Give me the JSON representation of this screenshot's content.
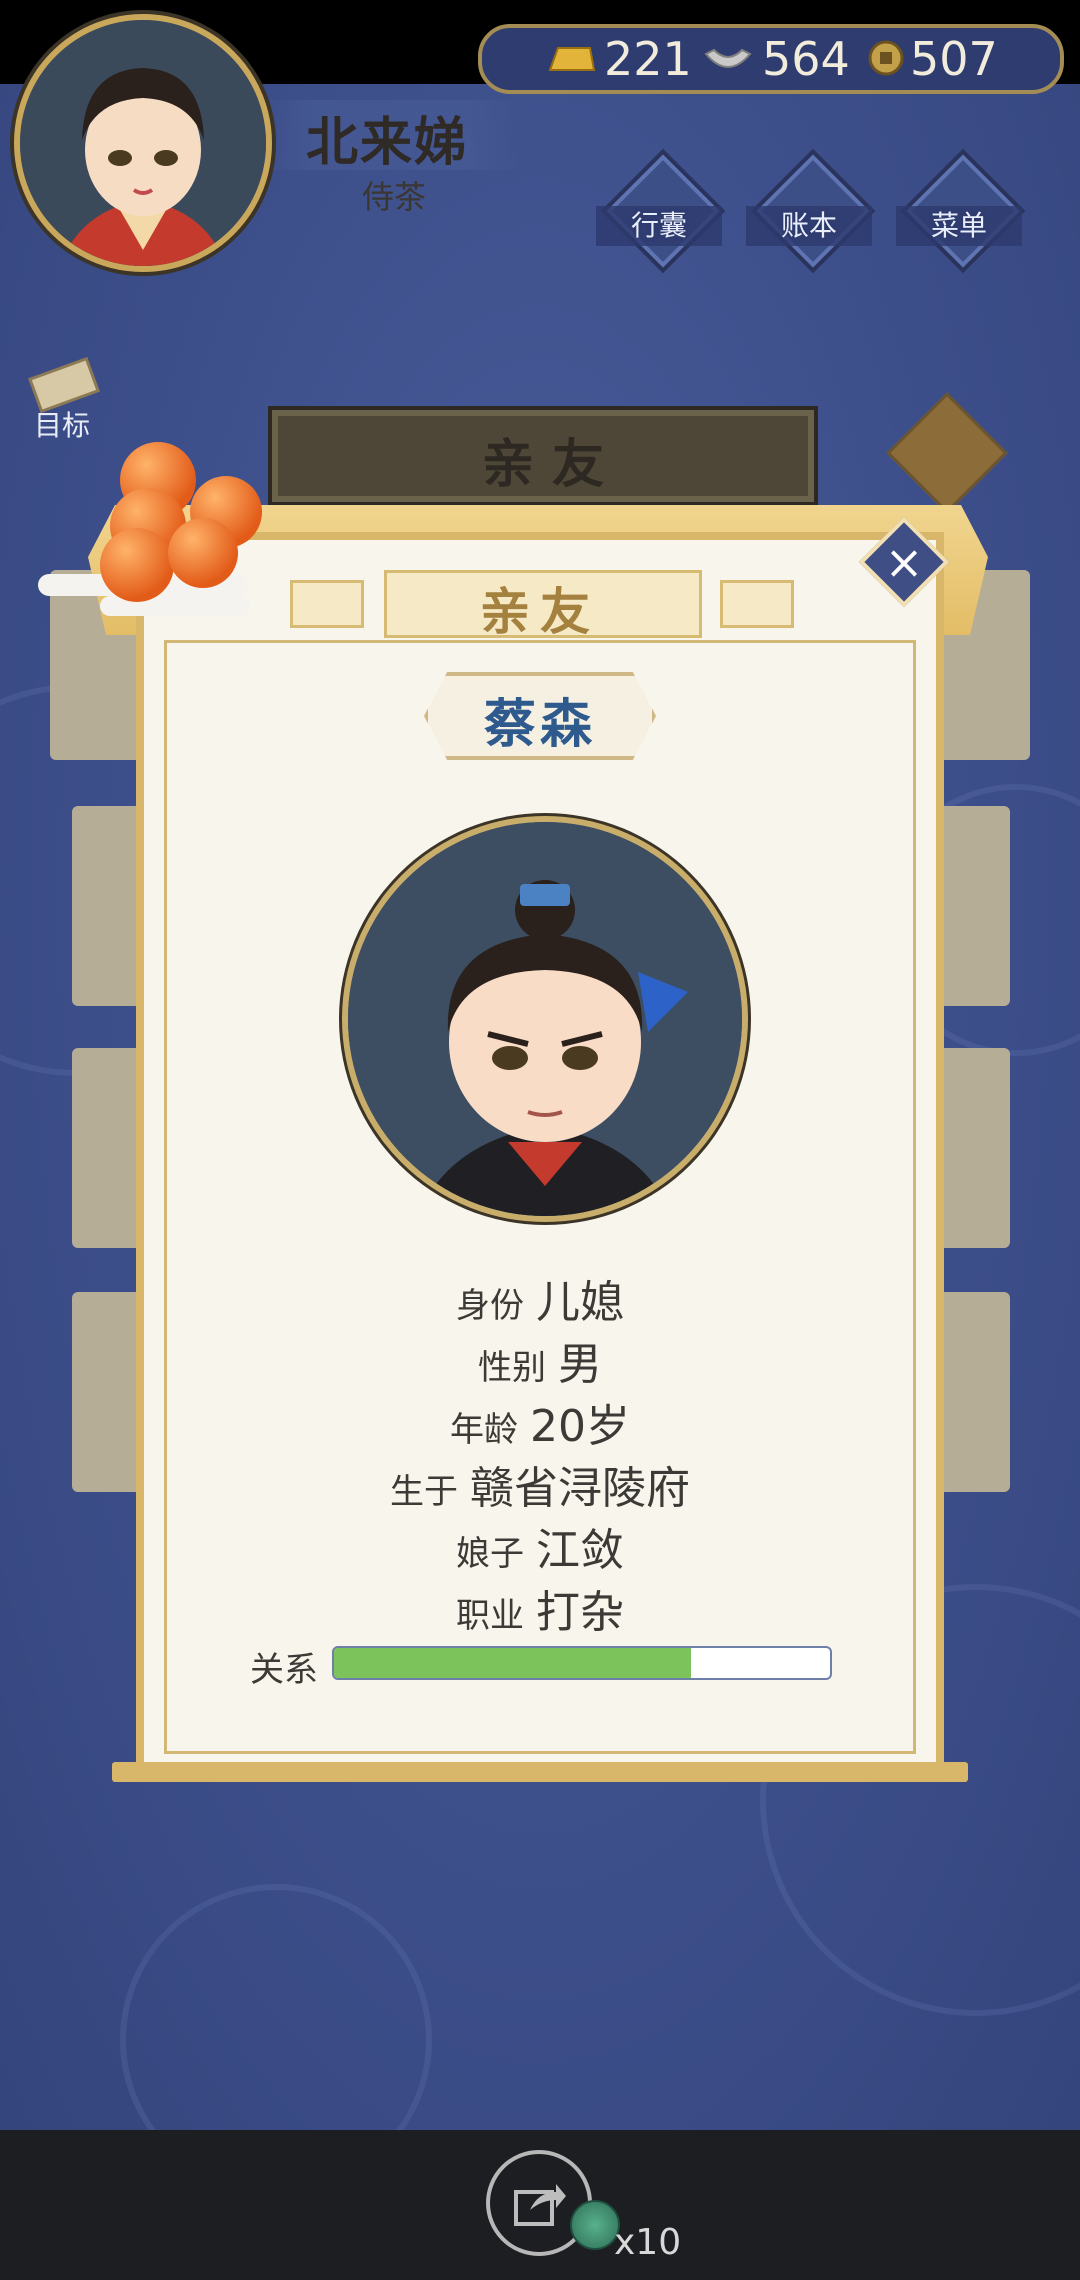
{
  "player": {
    "name": "北来娣",
    "rank": "侍茶"
  },
  "currency": {
    "gold": "221",
    "silver": "564",
    "coin": "507"
  },
  "menu": {
    "bag_label": "行囊",
    "ledger_label": "账本",
    "menu_label": "菜单"
  },
  "goal_label": "目标",
  "background_panel": {
    "title": "亲 友"
  },
  "dialog": {
    "title": "亲友",
    "name": "蔡森",
    "rows": [
      {
        "key": "身份",
        "value": "儿媳"
      },
      {
        "key": "性别",
        "value": "男"
      },
      {
        "key": "年龄",
        "value": "20岁"
      },
      {
        "key": "生于",
        "value": "赣省浔陵府"
      },
      {
        "key": "娘子",
        "value": "江敛"
      },
      {
        "key": "职业",
        "value": "打杂"
      }
    ],
    "relation_label": "关系",
    "relation_fraction": 0.72
  },
  "share": {
    "count": "x10"
  },
  "colors": {
    "accent_gold": "#d9b76a",
    "name_blue": "#2e5a8e",
    "relation_green": "#7bc35a",
    "background_blue": "#3d4f8b"
  },
  "icons": {
    "gold": "gold-ingot-icon",
    "silver": "silver-ingot-icon",
    "coin": "copper-coin-icon",
    "bag": "bag-icon",
    "ledger": "book-icon",
    "menu": "more-icon",
    "goal": "scroll-icon",
    "close": "close-icon",
    "share": "share-icon"
  }
}
